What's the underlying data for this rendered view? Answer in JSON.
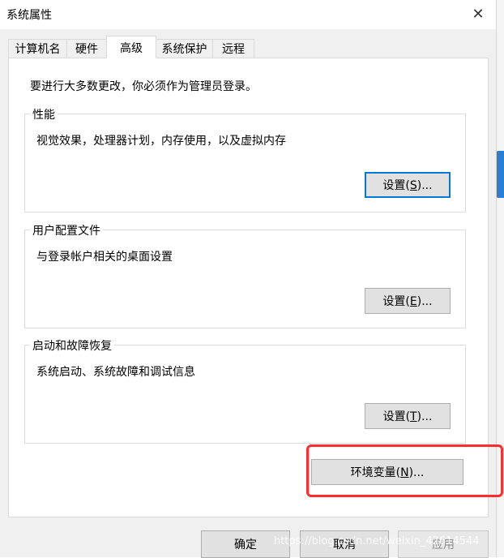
{
  "window": {
    "title": "系统属性"
  },
  "tabs": [
    {
      "label": "计算机名"
    },
    {
      "label": "硬件"
    },
    {
      "label": "高级"
    },
    {
      "label": "系统保护"
    },
    {
      "label": "远程"
    }
  ],
  "admin_note": "要进行大多数更改，你必须作为管理员登录。",
  "performance": {
    "title": "性能",
    "description": "视觉效果，处理器计划，内存使用，以及虚拟内存",
    "button_prefix": "设置(",
    "button_key": "S",
    "button_suffix": ")..."
  },
  "user_profiles": {
    "title": "用户配置文件",
    "description": "与登录帐户相关的桌面设置",
    "button_prefix": "设置(",
    "button_key": "E",
    "button_suffix": ")..."
  },
  "startup_recovery": {
    "title": "启动和故障恢复",
    "description": "系统启动、系统故障和调试信息",
    "button_prefix": "设置(",
    "button_key": "T",
    "button_suffix": ")..."
  },
  "env_button": {
    "prefix": "环境变量(",
    "key": "N",
    "suffix": ")..."
  },
  "footer": {
    "ok": "确定",
    "cancel": "取消",
    "apply": "应用"
  },
  "watermark": "https://blog.csdn.net/weixin_42614544",
  "colors": {
    "highlight": "#ff2d2d",
    "focus": "#0078d7"
  }
}
